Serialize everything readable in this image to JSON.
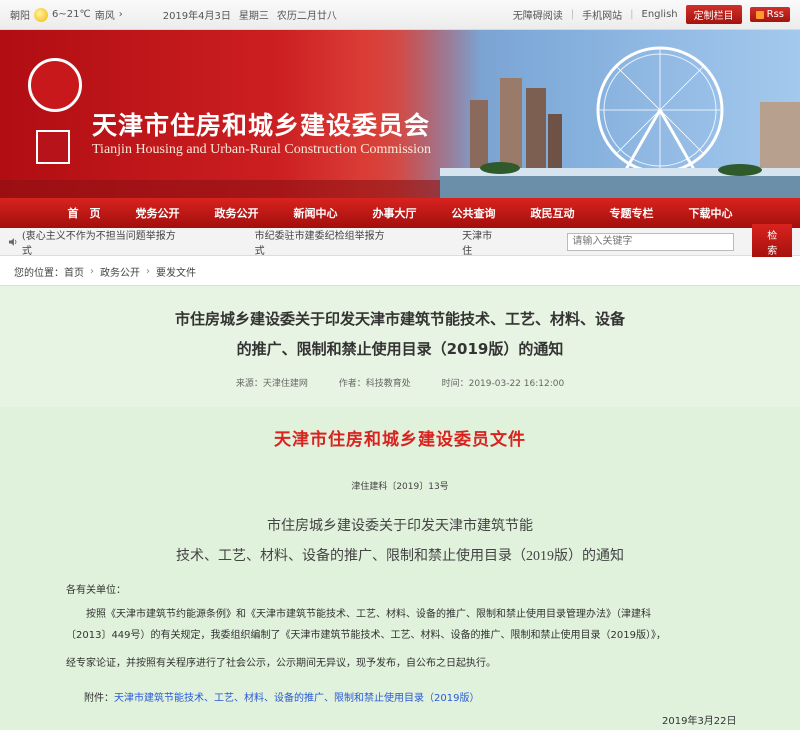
{
  "topbar": {
    "weather_label": "朝阳",
    "temperature": "6~21℃",
    "wind": "南风",
    "arrow": "›",
    "date": "2019年4月3日",
    "weekday": "星期三",
    "lunar": "农历二月廿八",
    "links": [
      "无障碍阅读",
      "手机网站",
      "English"
    ],
    "customize_label": "定制栏目",
    "rss_label": "Rss"
  },
  "banner": {
    "title": "天津市住房和城乡建设委员会",
    "subtitle": "Tianjin Housing and Urban-Rural Construction Commission"
  },
  "nav": {
    "items": [
      "首　页",
      "党务公开",
      "政务公开",
      "新闻中心",
      "办事大厅",
      "公共查询",
      "政民互动",
      "专题专栏",
      "下载中心"
    ]
  },
  "notice_bar": {
    "item1": "(衷心主义不作为不担当问题举报方式",
    "item2": "市纪委驻市建委纪检组举报方式",
    "item3": "天津市住",
    "search_placeholder": "请输入关键字",
    "search_button": "检索"
  },
  "breadcrumb": {
    "label": "您的位置：",
    "items": [
      "首页",
      "政务公开",
      "要发文件"
    ]
  },
  "article": {
    "title_line1": "市住房城乡建设委关于印发天津市建筑节能技术、工艺、材料、设备",
    "title_line2": "的推广、限制和禁止使用目录（2019版）的通知",
    "source": "来源：天津住建网",
    "author": "作者：科技教育处",
    "time": "时间：2019-03-22 16:12:00"
  },
  "document": {
    "header": "天津市住房和城乡建设委员文件",
    "doc_no": "津住建科〔2019〕13号",
    "notice_title_line1": "市住房城乡建设委关于印发天津市建筑节能",
    "notice_title_line2": "技术、工艺、材料、设备的推广、限制和禁止使用目录（2019版）的通知",
    "salutation": "各有关单位：",
    "para1": "　　按照《天津市建筑节约能源条例》和《天津市建筑节能技术、工艺、材料、设备的推广、限制和禁止使用目录管理办法》（津建科",
    "para2": "〔2013〕449号）的有关规定，我委组织编制了《天津市建筑节能技术、工艺、材料、设备的推广、限制和禁止使用目录（2019版）》，",
    "para3": "经专家论证，并按照有关程序进行了社会公示，公示期间无异议，现予发布，自公布之日起执行。",
    "attach_label": "附件：",
    "attach_link": "天津市建筑节能技术、工艺、材料、设备的推广、限制和禁止使用目录（2019版）",
    "sign_date": "2019年3月22日"
  },
  "colors": {
    "brand_red": "#d8231f",
    "body_green": "#e0f1dc",
    "link_blue": "#2a5bd7"
  }
}
